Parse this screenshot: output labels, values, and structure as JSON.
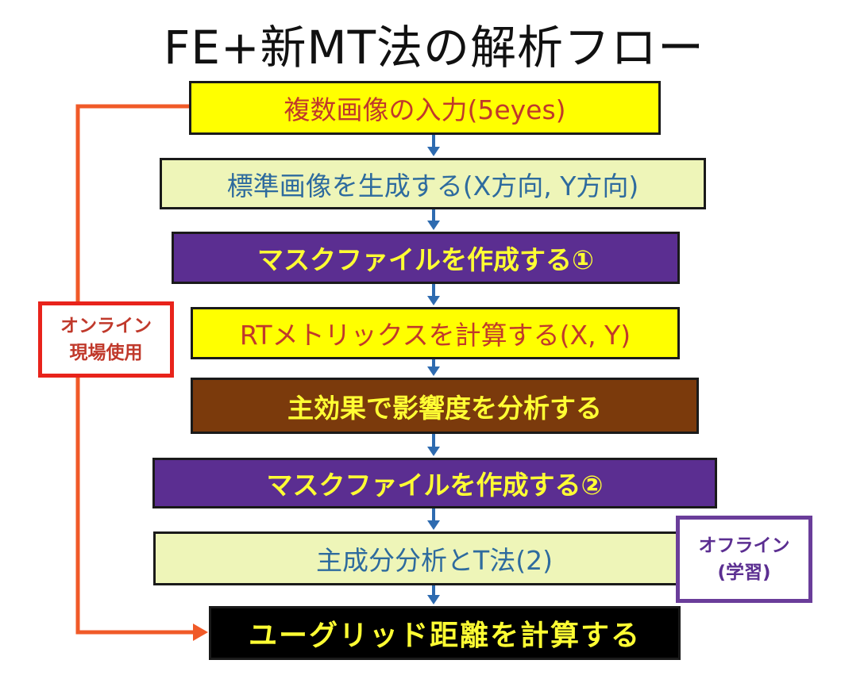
{
  "title": "FE+新MT法の解析フロー",
  "steps": [
    {
      "label": "複数画像の入力(5eyes)"
    },
    {
      "label": "標準画像を生成する(X方向, Y方向)"
    },
    {
      "label": "マスクファイルを作成する①"
    },
    {
      "label": "RTメトリックスを計算する(X, Y)"
    },
    {
      "label": "主効果で影響度を分析する"
    },
    {
      "label": "マスクファイルを作成する②"
    },
    {
      "label": "主成分分析とT法(2)"
    },
    {
      "label": "ユーグリッド距離を計算する"
    }
  ],
  "online_label": {
    "line1": "オンライン",
    "line2": "現場使用"
  },
  "offline_label": {
    "line1": "オフライン",
    "line2": "(学習)"
  },
  "colors": {
    "arrow": "#2e6bb0",
    "loop_arrow": "#f05a28",
    "online_border": "#e8231b",
    "offline_border": "#6a3d9a"
  }
}
